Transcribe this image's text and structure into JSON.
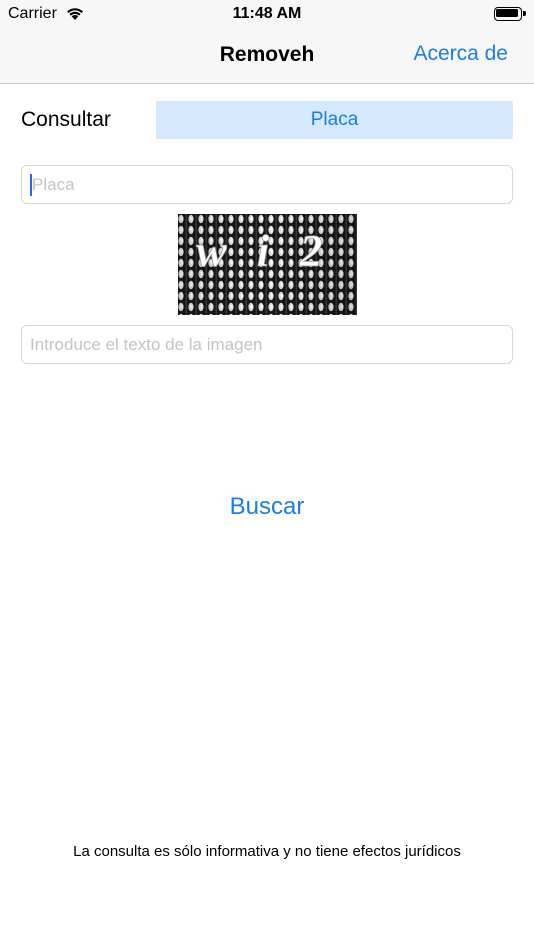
{
  "status_bar": {
    "carrier": "Carrier",
    "time": "11:48 AM"
  },
  "nav": {
    "title": "Removeh",
    "action": "Acerca de"
  },
  "form": {
    "consultar_label": "Consultar",
    "segment_selected": "Placa",
    "plate_placeholder": "Placa",
    "captcha_text": "wi2",
    "captcha_placeholder": "Introduce el texto de la imagen",
    "search_label": "Buscar"
  },
  "footer": {
    "disclaimer": "La consulta es sólo informativa y no tiene efectos jurídicos"
  },
  "colors": {
    "accent": "#1b7fe0",
    "segment_bg": "#d4e9fb",
    "bar_bg": "#f7f7f7"
  },
  "icons": [
    "wifi-icon",
    "battery-icon",
    "captcha-image"
  ]
}
